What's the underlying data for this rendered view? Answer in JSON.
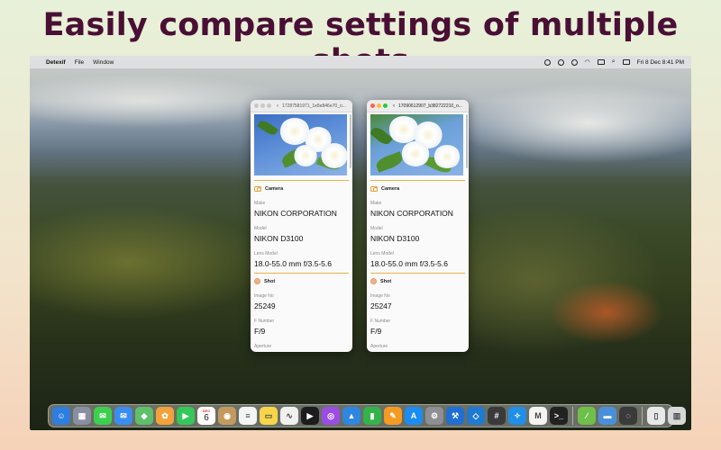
{
  "headline": "Easily compare settings of multiple shots",
  "menubar": {
    "app_name": "Detexif",
    "menus": [
      "File",
      "Window"
    ],
    "clock": "Fri 8 Dec 8:41 PM"
  },
  "windows": [
    {
      "title": "17287581971_1e8e846e70_o...",
      "active": false,
      "camera_section": "Camera",
      "shot_section": "Shot",
      "fields": {
        "make_label": "Make",
        "make_value": "NIKON CORPORATION",
        "model_label": "Model",
        "model_value": "NIKON D3100",
        "lens_label": "Lens Model",
        "lens_value": "18.0-55.0 mm f/3.5-5.6",
        "image_no_label": "Image No",
        "image_no_value": "25249",
        "fnumber_label": "F Number",
        "fnumber_value": "F/9",
        "aperture_label": "Aperture"
      }
    },
    {
      "title": "17090612907_b382722210_o...",
      "active": true,
      "camera_section": "Camera",
      "shot_section": "Shot",
      "fields": {
        "make_label": "Make",
        "make_value": "NIKON CORPORATION",
        "model_label": "Model",
        "model_value": "NIKON D3100",
        "lens_label": "Lens Model",
        "lens_value": "18.0-55.0 mm f/3.5-5.6",
        "image_no_label": "Image No",
        "image_no_value": "25247",
        "fnumber_label": "F Number",
        "fnumber_value": "F/9",
        "aperture_label": "Aperture"
      }
    }
  ],
  "dock": {
    "calendar_month": "DEC",
    "calendar_day": "6",
    "apps": [
      {
        "name": "finder-icon",
        "color": "#2f7de1",
        "glyph": "☺"
      },
      {
        "name": "launchpad-icon",
        "color": "#8a8fa0",
        "glyph": "▦"
      },
      {
        "name": "messages-icon",
        "color": "#3ccf4e",
        "glyph": "✉"
      },
      {
        "name": "mail-icon",
        "color": "#3a8ef0",
        "glyph": "✉"
      },
      {
        "name": "maps-icon",
        "color": "#5fbf6a",
        "glyph": "◆"
      },
      {
        "name": "photos-icon",
        "color": "#f2a23a",
        "glyph": "✿"
      },
      {
        "name": "facetime-icon",
        "color": "#35c759",
        "glyph": "▶"
      },
      {
        "name": "calendar-icon",
        "color": "#ffffff",
        "glyph": ""
      },
      {
        "name": "contacts-icon",
        "color": "#c39a5e",
        "glyph": "◉"
      },
      {
        "name": "reminders-icon",
        "color": "#f4f4f4",
        "glyph": "≡"
      },
      {
        "name": "notes-icon",
        "color": "#f7d54a",
        "glyph": "▭"
      },
      {
        "name": "freeform-icon",
        "color": "#f0f0f0",
        "glyph": "∿"
      },
      {
        "name": "appletv-icon",
        "color": "#1c1c1e",
        "glyph": "▶"
      },
      {
        "name": "podcasts-icon",
        "color": "#9b4de3",
        "glyph": "◎"
      },
      {
        "name": "keynote-icon",
        "color": "#2e86de",
        "glyph": "▲"
      },
      {
        "name": "numbers-icon",
        "color": "#34b34a",
        "glyph": "▮"
      },
      {
        "name": "pages-icon",
        "color": "#f59a23",
        "glyph": "✎"
      },
      {
        "name": "appstore-icon",
        "color": "#1b8cf2",
        "glyph": "A"
      },
      {
        "name": "system-settings-icon",
        "color": "#8e8e93",
        "glyph": "⚙"
      },
      {
        "name": "xcode-icon",
        "color": "#1f6fd1",
        "glyph": "⚒"
      },
      {
        "name": "vscode-icon",
        "color": "#1e7ad1",
        "glyph": "◇"
      },
      {
        "name": "calculator-icon",
        "color": "#3a3a3c",
        "glyph": "#"
      },
      {
        "name": "safari-icon",
        "color": "#1f8fe8",
        "glyph": "✧"
      },
      {
        "name": "gmail-icon",
        "color": "#f4f4f4",
        "glyph": "M"
      },
      {
        "name": "terminal-icon",
        "color": "#222222",
        "glyph": ">_"
      }
    ],
    "recent": [
      {
        "name": "grapher-icon",
        "color": "#6fbf4a",
        "glyph": "∕"
      },
      {
        "name": "preview-icon",
        "color": "#4a90d9",
        "glyph": "▬"
      },
      {
        "name": "detexif-icon",
        "color": "#3a3a3a",
        "glyph": "◌"
      }
    ],
    "tail": [
      {
        "name": "document-icon",
        "color": "#e8e8e8",
        "glyph": "▯"
      },
      {
        "name": "trash-icon",
        "color": "#d8d8d8",
        "glyph": "▥"
      }
    ]
  }
}
